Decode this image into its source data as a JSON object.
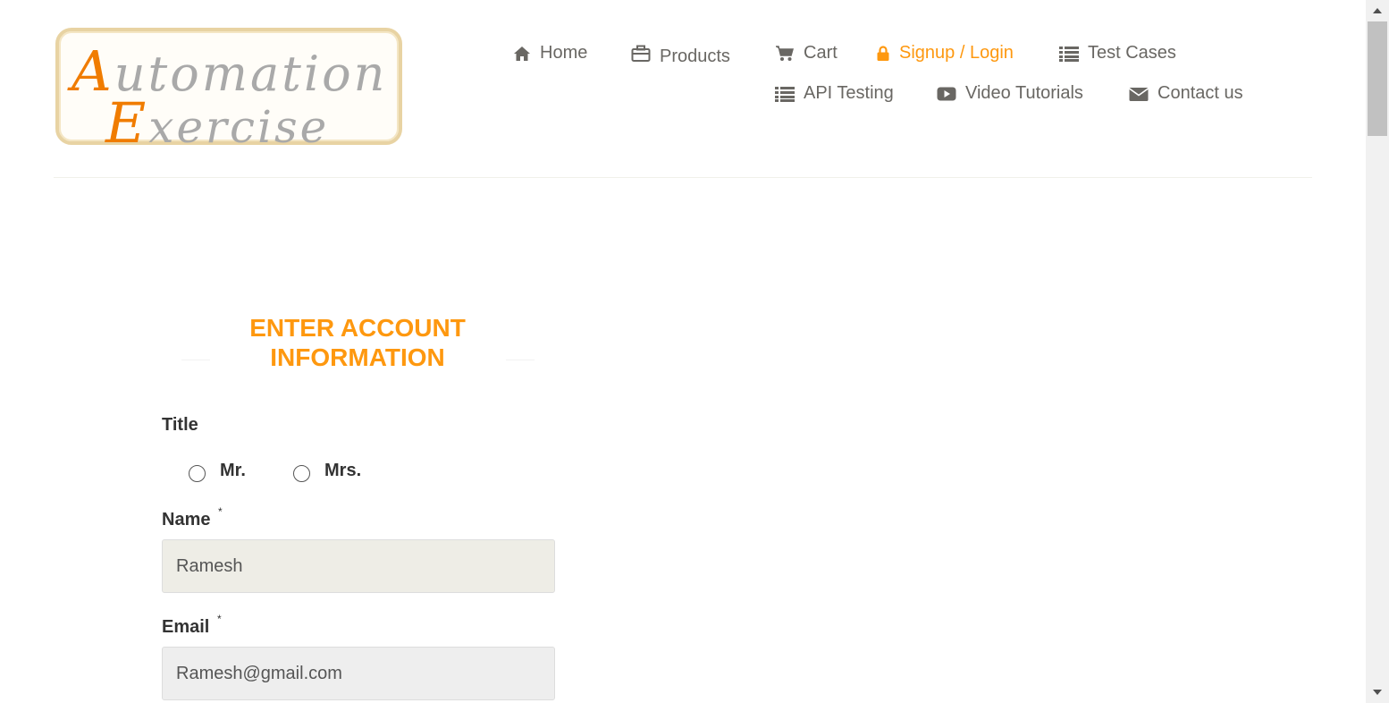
{
  "logo": {
    "line1_cap": "A",
    "line1_rest": "utomation",
    "line2_cap": "E",
    "line2_rest": "xercise"
  },
  "nav": {
    "items": [
      {
        "label": "Home",
        "icon": "home-icon"
      },
      {
        "label": "Products",
        "icon": "briefcase-icon"
      },
      {
        "label": "Cart",
        "icon": "cart-icon"
      },
      {
        "label": "Signup / Login",
        "icon": "lock-icon",
        "active": true
      },
      {
        "label": "Test Cases",
        "icon": "list-icon"
      },
      {
        "label": "API Testing",
        "icon": "list-icon"
      },
      {
        "label": "Video Tutorials",
        "icon": "youtube-play-icon"
      },
      {
        "label": "Contact us",
        "icon": "envelope-icon"
      }
    ]
  },
  "form": {
    "heading_line1": "ENTER ACCOUNT",
    "heading_line2": "INFORMATION",
    "title_label": "Title",
    "title_options": [
      "Mr.",
      "Mrs."
    ],
    "name_label": "Name",
    "name_value": "Ramesh",
    "email_label": "Email",
    "email_value": "Ramesh@gmail.com",
    "required_mark": "*"
  },
  "colors": {
    "accent": "#fe980f",
    "nav_text": "#696763",
    "logo_orange": "#f07c00",
    "logo_border": "#e8d3a3"
  }
}
